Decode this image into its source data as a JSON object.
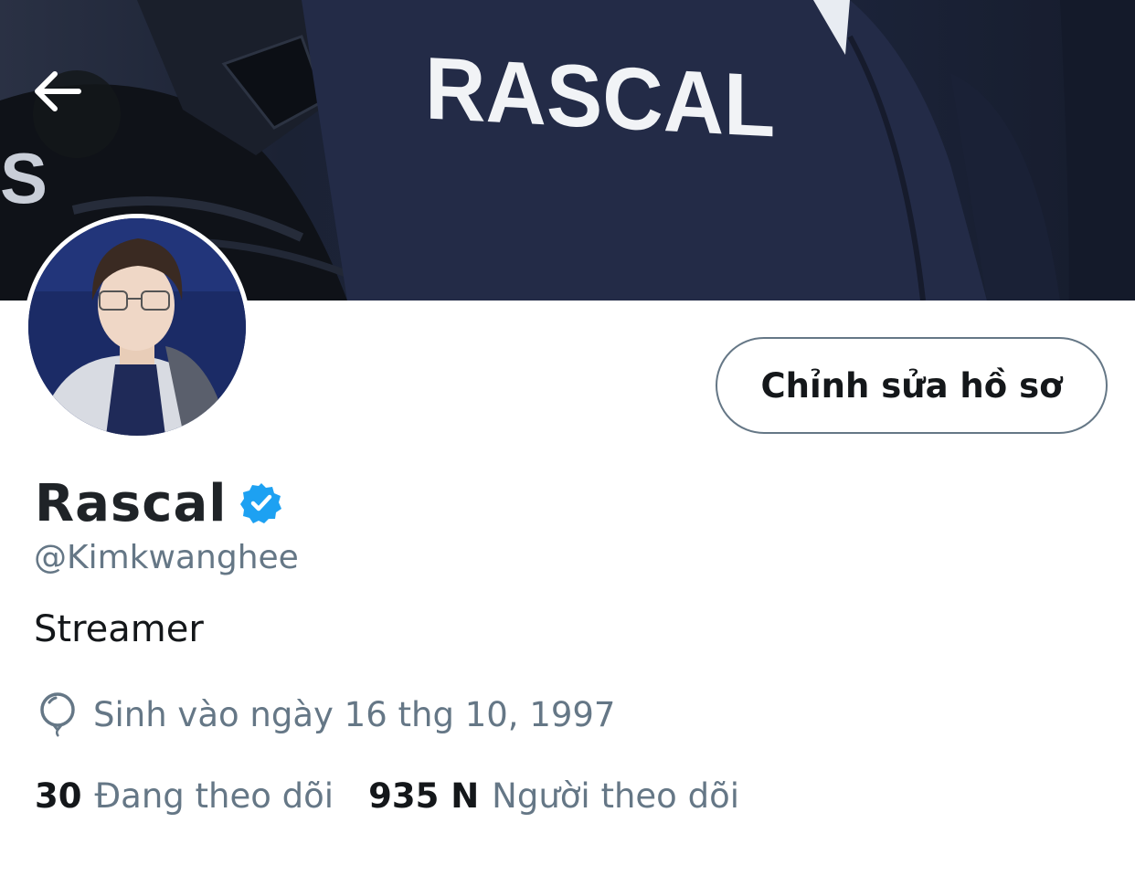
{
  "banner": {
    "image_description": "navy jacket with RASCAL text",
    "jacket_text": "RASCAL",
    "side_text": "S"
  },
  "profile": {
    "display_name": "Rascal",
    "verified": true,
    "handle": "@Kimkwanghee",
    "bio": "Streamer",
    "birthday": "Sinh vào ngày 16 thg 10, 1997"
  },
  "actions": {
    "edit_profile_label": "Chỉnh sửa hồ sơ"
  },
  "stats": {
    "following_count": "30",
    "following_label": "Đang theo dõi",
    "followers_count": "935 N",
    "followers_label": "Người theo dõi"
  },
  "icons": {
    "back": "arrow-left-icon",
    "verified": "verified-badge-icon",
    "birthday": "balloon-icon"
  },
  "colors": {
    "verified_blue": "#1da1f2",
    "secondary_text": "#657786",
    "primary_text": "#14171a",
    "button_border": "#657786"
  }
}
